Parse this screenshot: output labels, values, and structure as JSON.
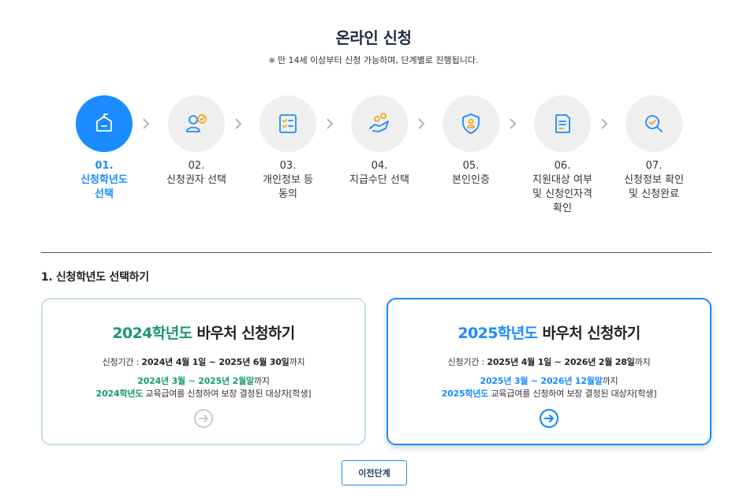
{
  "page": {
    "title": "온라인 신청",
    "notice_mark": "※",
    "notice": "만 14세 이상부터 신청 가능하며, 단계별로 진행됩니다."
  },
  "steps": [
    {
      "num": "01.",
      "label": "신청학년도 선택",
      "icon": "school-icon",
      "active": true
    },
    {
      "num": "02.",
      "label": "신청권자 선택",
      "icon": "user-check-icon",
      "active": false
    },
    {
      "num": "03.",
      "label": "개인정보 등 동의",
      "icon": "checklist-icon",
      "active": false
    },
    {
      "num": "04.",
      "label": "지급수단 선택",
      "icon": "hand-coins-icon",
      "active": false
    },
    {
      "num": "05.",
      "label": "본인인증",
      "icon": "shield-user-icon",
      "active": false
    },
    {
      "num": "06.",
      "label": "지원대상 여부 및 신청인자격 확인",
      "icon": "document-icon",
      "active": false
    },
    {
      "num": "07.",
      "label": "신청정보 확인 및 신청완료",
      "icon": "search-check-icon",
      "active": false
    }
  ],
  "section": {
    "title": "1. 신청학년도 선택하기"
  },
  "cards": {
    "c2024": {
      "title_year": "2024학년도",
      "title_rest": " 바우처 신청하기",
      "period_label": "신청기간 : ",
      "period_value": "2024년 4월 1일 ~ 2025년 6월 30일",
      "period_suffix": "까지",
      "range": "2024년 3월 ~ 2025년 2월말",
      "range_suffix": "까지",
      "target_year": "2024학년도",
      "target_rest": " 교육급여를 신청하여 보장 결정된 대상자[학생]",
      "color": "#1a9a6c"
    },
    "c2025": {
      "title_year": "2025학년도",
      "title_rest": " 바우처 신청하기",
      "period_label": "신청기간 : ",
      "period_value": "2025년 4월 1일 ~ 2026년 2월 28일",
      "period_suffix": "까지",
      "range": "2025년 3월 ~ 2026년 12월말",
      "range_suffix": "까지",
      "target_year": "2025학년도",
      "target_rest": " 교육급여를 신청하여 보장 결정된 대상자[학생]",
      "color": "#1a8cff"
    }
  },
  "buttons": {
    "prev": "이전단계"
  },
  "colors": {
    "accent": "#1a8cff",
    "green": "#1a9a6c",
    "icon_gold": "#f4a51c"
  }
}
